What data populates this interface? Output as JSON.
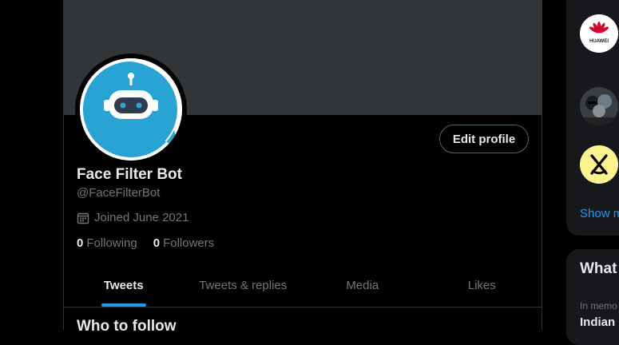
{
  "profile": {
    "name": "Face Filter Bot",
    "handle": "@FaceFilterBot",
    "joined": "Joined June 2021",
    "following_count": "0",
    "following_label": "Following",
    "followers_count": "0",
    "followers_label": "Followers",
    "edit_label": "Edit profile",
    "avatar_bg": "#1da1f2"
  },
  "tabs": [
    {
      "label": "Tweets",
      "active": true
    },
    {
      "label": "Tweets & replies",
      "active": false
    },
    {
      "label": "Media",
      "active": false
    },
    {
      "label": "Likes",
      "active": false
    }
  ],
  "who_to_follow": {
    "title": "Who to follow"
  },
  "sidebar": {
    "suggestions": [
      {
        "icon": "huawei-logo",
        "logo_text": "HUAWEI"
      },
      {
        "icon": "group-photo"
      },
      {
        "icon": "snp-logo"
      }
    ],
    "show_more": "Show m",
    "whats_happening": "What",
    "trend_context": "In memo",
    "trend_title": "Indian"
  },
  "colors": {
    "accent": "#1d9bf0",
    "background": "#000000",
    "banner": "#333639",
    "border": "#2f3336",
    "muted_text": "#71767b"
  }
}
